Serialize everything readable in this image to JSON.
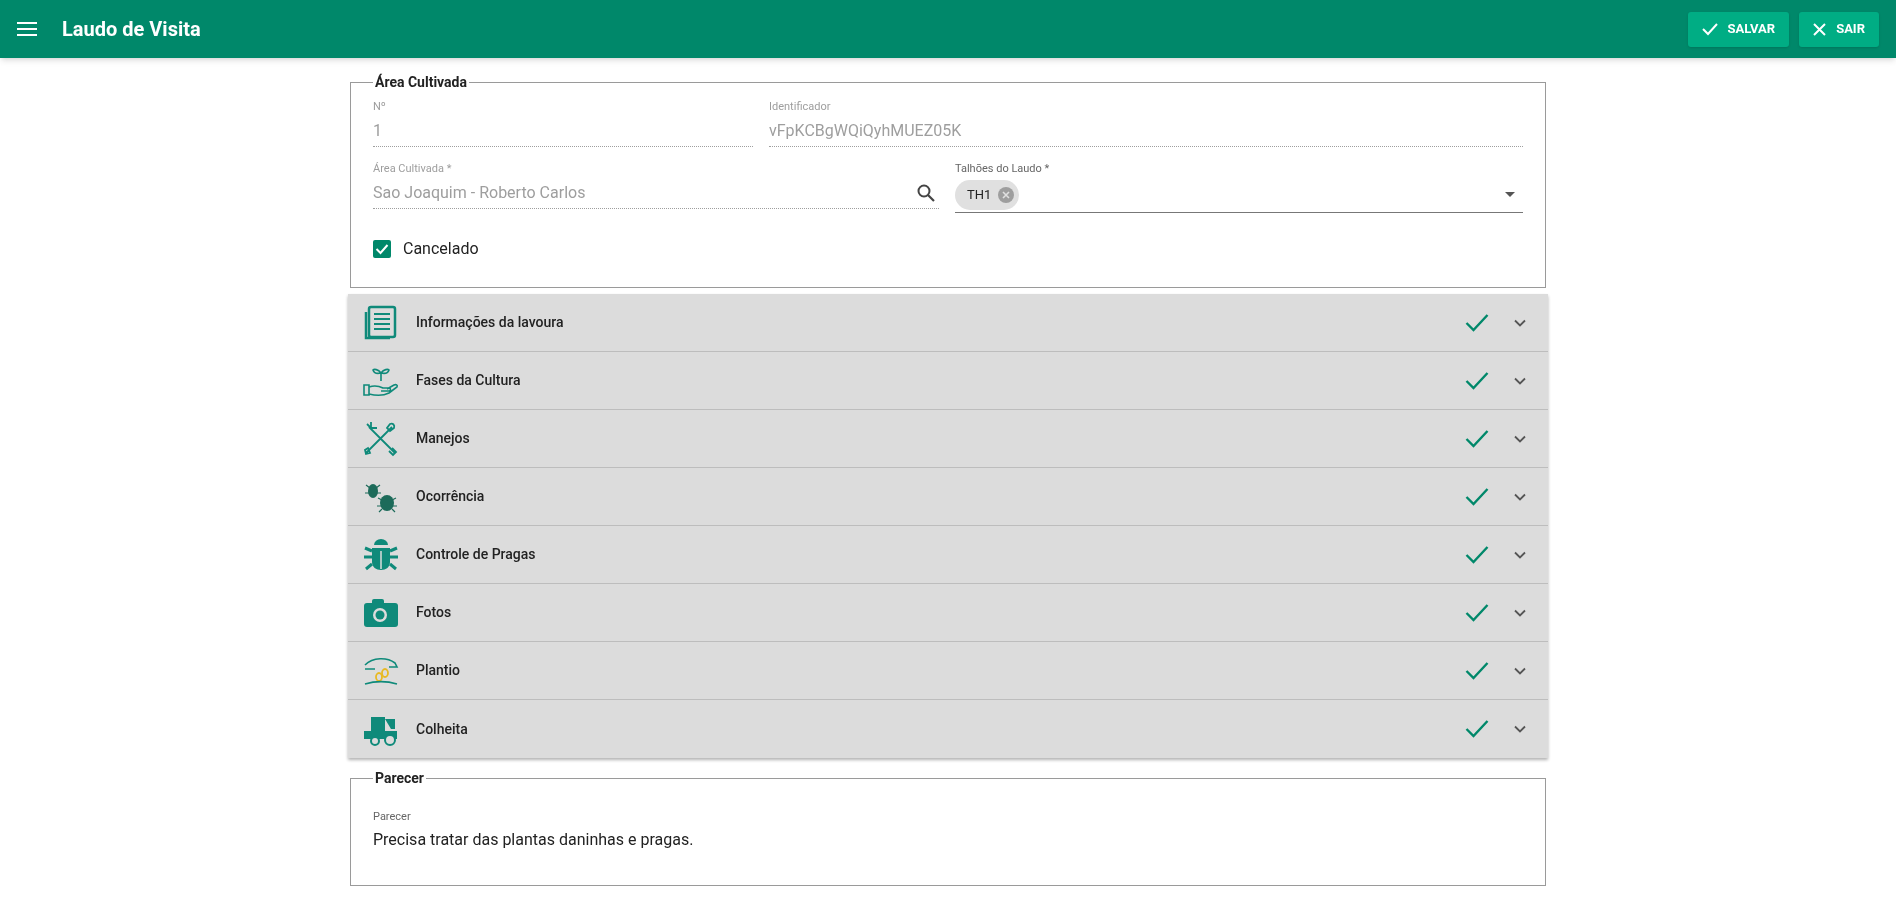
{
  "app_bar": {
    "title": "Laudo de Visita",
    "buttons": [
      {
        "kind": "save",
        "label": "SALVAR"
      },
      {
        "kind": "exit",
        "label": "SAIR"
      }
    ]
  },
  "area_cultivada": {
    "legend": "Área Cultivada",
    "fields": [
      {
        "label": "Nº",
        "value": "1",
        "disabled": true
      },
      {
        "label": "Identificador",
        "value": "vFpKCBgWQiQyhMUEZ05K",
        "disabled": true
      }
    ],
    "area_field": {
      "label": "Área Cultivada *",
      "value": "Sao Joaquim - Roberto Carlos",
      "disabled": true
    },
    "talhoes_field": {
      "label": "Talhões do Laudo *",
      "chips": [
        "TH1"
      ]
    },
    "cancelado": {
      "label": "Cancelado",
      "checked": true
    }
  },
  "sections": [
    {
      "kind": "document",
      "title": "Informações da lavoura",
      "completed": true,
      "expanded": false
    },
    {
      "kind": "seedling",
      "title": "Fases da Cultura",
      "completed": true,
      "expanded": false
    },
    {
      "kind": "tools",
      "title": "Manejos",
      "completed": true,
      "expanded": false
    },
    {
      "kind": "bugs",
      "title": "Ocorrência",
      "completed": true,
      "expanded": false
    },
    {
      "kind": "bug",
      "title": "Controle de Pragas",
      "completed": true,
      "expanded": false
    },
    {
      "kind": "camera",
      "title": "Fotos",
      "completed": true,
      "expanded": false
    },
    {
      "kind": "hand-seed",
      "title": "Plantio",
      "completed": true,
      "expanded": false
    },
    {
      "kind": "harvester",
      "title": "Colheita",
      "completed": true,
      "expanded": false
    }
  ],
  "parecer": {
    "legend": "Parecer",
    "label": "Parecer",
    "value": "Precisa tratar das plantas daninhas e pragas."
  }
}
